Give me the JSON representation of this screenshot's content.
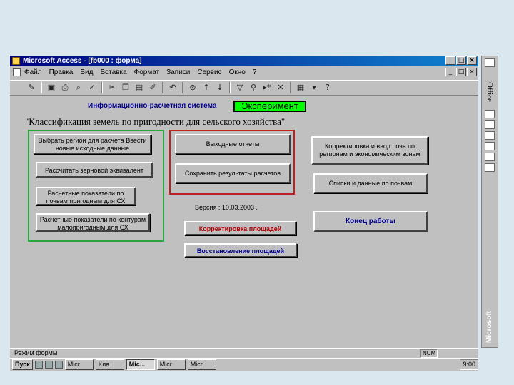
{
  "window": {
    "title": "Microsoft Access - [fb000 : форма]",
    "controls": [
      "_",
      "□",
      "×"
    ]
  },
  "menu": {
    "items": [
      "Файл",
      "Правка",
      "Вид",
      "Вставка",
      "Формат",
      "Записи",
      "Сервис",
      "Окно",
      "?"
    ],
    "doc_controls": [
      "_",
      "□",
      "×"
    ]
  },
  "toolbar": {
    "icons": [
      "design-icon",
      "save-icon",
      "print-icon",
      "preview-icon",
      "spelling-icon",
      "cut-icon",
      "copy-icon",
      "paste-icon",
      "format-painter-icon",
      "undo-icon",
      "hyperlink-icon",
      "sort-asc-icon",
      "sort-desc-icon",
      "filter-icon",
      "find-icon",
      "new-record-icon",
      "delete-record-icon",
      "database-window-icon",
      "new-object-icon",
      "help-icon"
    ]
  },
  "form": {
    "subtitle": "Информационно-расчетная система",
    "badge": "Эксперимент",
    "heading": "\"Классификация земель по пригодности для сельского хозяйства\"",
    "buttons": {
      "choose_region": "Выбрать регион для расчета Ввести новые исходные данные",
      "calc_grain": "Рассчитать зерновой эквивалент",
      "soil_indicators": "Расчетные показатели по почвам пригодным для СХ",
      "contour_indicators": "Расчетные показатели по контурам малопригодным для СХ",
      "output_reports": "Выходные отчеты",
      "save_results": "Сохранить результаты расчетов",
      "correct_soils": "Корректировка и ввод почв по регионам и экономическим зонам",
      "soil_lists": "Списки и данные по почвам",
      "correct_areas": "Корректировка площадей",
      "restore_areas": "Восстановление площадей",
      "exit": "Конец работы"
    },
    "version": "Версия : 10.03.2003 ."
  },
  "statusbar": {
    "text": "Режим формы",
    "num": "NUM"
  },
  "taskbar": {
    "start": "Пуск",
    "tasks": [
      "Micr",
      "Кла",
      "Mic...",
      "Micr",
      "Micr"
    ],
    "clock": "9:00"
  },
  "office": {
    "label": "Office",
    "vendor": "Microsoft"
  }
}
